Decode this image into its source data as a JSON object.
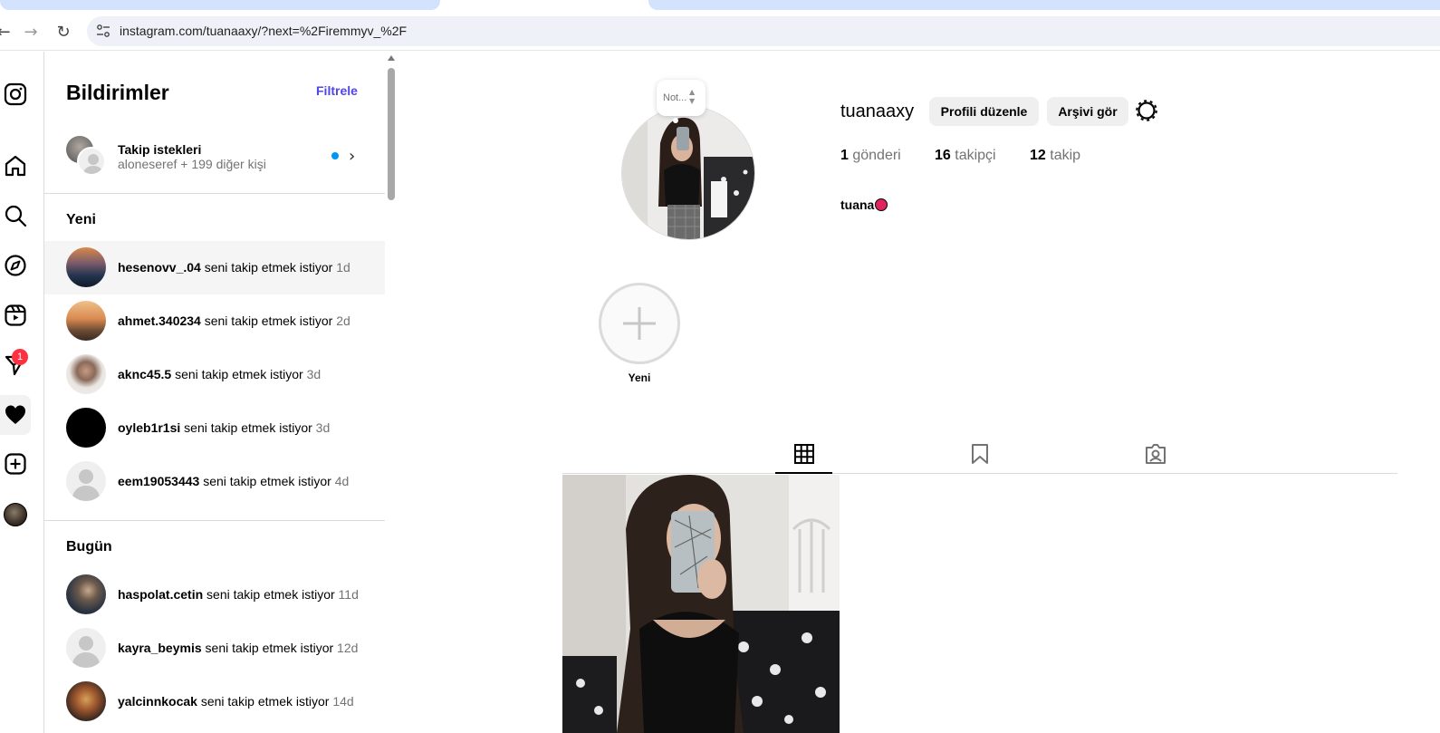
{
  "browser": {
    "url": "instagram.com/tuanaaxy/?next=%2Firemmyv_%2F",
    "back_icon": "back-arrow-icon",
    "forward_icon": "forward-arrow-icon",
    "reload_icon": "reload-icon"
  },
  "rail": {
    "messages_badge": "1"
  },
  "notifications": {
    "title": "Bildirimler",
    "filter_label": "Filtrele",
    "requests": {
      "title": "Takip istekleri",
      "subtitle": "aloneseref + 199 diğer kişi"
    },
    "sections": [
      {
        "title": "Yeni",
        "items": [
          {
            "user": "hesenovv_.04",
            "text": "seni takip etmek istiyor",
            "time": "1d"
          },
          {
            "user": "ahmet.340234",
            "text": "seni takip etmek istiyor",
            "time": "2d"
          },
          {
            "user": "aknc45.5",
            "text": "seni takip etmek istiyor",
            "time": "3d"
          },
          {
            "user": "oyleb1r1si",
            "text": "seni takip etmek istiyor",
            "time": "3d"
          },
          {
            "user": "eem19053443",
            "text": "seni takip etmek istiyor",
            "time": "4d"
          }
        ]
      },
      {
        "title": "Bugün",
        "items": [
          {
            "user": "haspolat.cetin",
            "text": "seni takip etmek istiyor",
            "time": "11d"
          },
          {
            "user": "kayra_beymis",
            "text": "seni takip etmek istiyor",
            "time": "12d"
          },
          {
            "user": "yalcinnkocak",
            "text": "seni takip etmek istiyor",
            "time": "14d"
          }
        ]
      }
    ]
  },
  "profile": {
    "note_text": "Not...",
    "username": "tuanaaxy",
    "edit_button": "Profili düzenle",
    "archive_button": "Arşivi gör",
    "posts_count": "1",
    "posts_label": "gönderi",
    "followers_count": "16",
    "followers_label": "takipçi",
    "following_count": "12",
    "following_label": "takip",
    "full_name": "tuana",
    "highlight_new_label": "Yeni"
  },
  "colors": {
    "accent_link": "#4f46e5",
    "badge_red": "#ff3040",
    "unread_blue": "#0095f6"
  }
}
